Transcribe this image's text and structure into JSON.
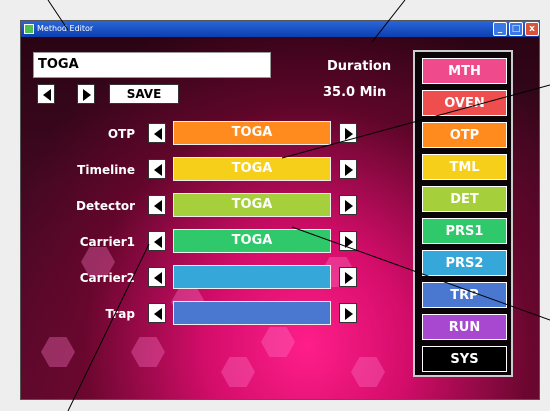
{
  "window": {
    "title": "Method Editor",
    "minimize_glyph": "_",
    "maximize_glyph": "□",
    "close_glyph": "x"
  },
  "method_name": {
    "value": "TOGA"
  },
  "toolbar": {
    "save_label": "SAVE"
  },
  "duration": {
    "label": "Duration",
    "value": "35.0 Min"
  },
  "rows": [
    {
      "label": "OTP",
      "value": "TOGA",
      "color": "#ff8a1e"
    },
    {
      "label": "Timeline",
      "value": "TOGA",
      "color": "#f5cf1a"
    },
    {
      "label": "Detector",
      "value": "TOGA",
      "color": "#a6cf3c"
    },
    {
      "label": "Carrier1",
      "value": "TOGA",
      "color": "#2fc86a"
    },
    {
      "label": "Carrier2",
      "value": "",
      "color": "#35a7d8"
    },
    {
      "label": "Trap",
      "value": "",
      "color": "#4a78d0"
    }
  ],
  "side_menu": [
    {
      "label": "MTH",
      "color": "#ef4a8c"
    },
    {
      "label": "OVEN",
      "color": "#ef4e4e"
    },
    {
      "label": "OTP",
      "color": "#ff8a1e"
    },
    {
      "label": "TML",
      "color": "#f5cf1a"
    },
    {
      "label": "DET",
      "color": "#a6cf3c"
    },
    {
      "label": "PRS1",
      "color": "#2fc86a"
    },
    {
      "label": "PRS2",
      "color": "#35a7d8"
    },
    {
      "label": "TRP",
      "color": "#4a78d0"
    },
    {
      "label": "RUN",
      "color": "#a848d0"
    },
    {
      "label": "SYS",
      "color": "#000000"
    }
  ]
}
